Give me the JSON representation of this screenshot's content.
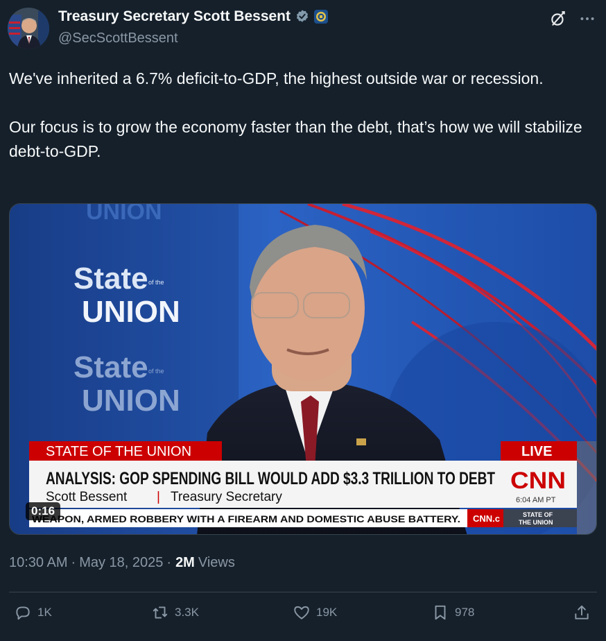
{
  "author": {
    "display_name": "Treasury Secretary Scott Bessent",
    "handle": "@SecScottBessent",
    "verified_icon": "verified-badge-icon",
    "affiliation_icon": "treasury-seal-icon"
  },
  "tweet": {
    "paragraphs": [
      "We've inherited a 6.7% deficit-to-GDP, the highest outside war or recession.",
      "Our focus is to grow the economy faster than the debt, that’s how we will stabilize debt-to-GDP."
    ]
  },
  "video": {
    "duration": "0:16",
    "bg_logo_top": "State",
    "bg_logo_small": "of the",
    "bg_logo_bottom": "UNION",
    "bg_watermark": "UNION",
    "show_label": "STATE OF THE UNION",
    "live_label": "LIVE",
    "headline": "ANALYSIS: GOP SPENDING BILL WOULD ADD $3.3 TRILLION TO DEBT",
    "guest_name": "Scott Bessent",
    "separator": "|",
    "guest_title": "Treasury Secretary",
    "network": "CNN",
    "time": "6:04 AM PT",
    "ticker": "WEAPON, ARMED ROBBERY WITH A FIREARM AND DOMESTIC ABUSE BATTERY.",
    "ticker_logo": "CNN.c",
    "ticker_show_line1": "STATE OF",
    "ticker_show_line2": "THE UNION"
  },
  "meta": {
    "time": "10:30 AM",
    "dot": "·",
    "date": "May 18, 2025",
    "dot2": "·",
    "views_count": "2M",
    "views_label": "Views"
  },
  "actions": {
    "replies": "1K",
    "reposts": "3.3K",
    "likes": "19K",
    "bookmarks": "978"
  },
  "colors": {
    "background": "#15202b",
    "text": "#f7f9f9",
    "secondary": "#8b98a5",
    "cnn_red": "#cc0000"
  }
}
